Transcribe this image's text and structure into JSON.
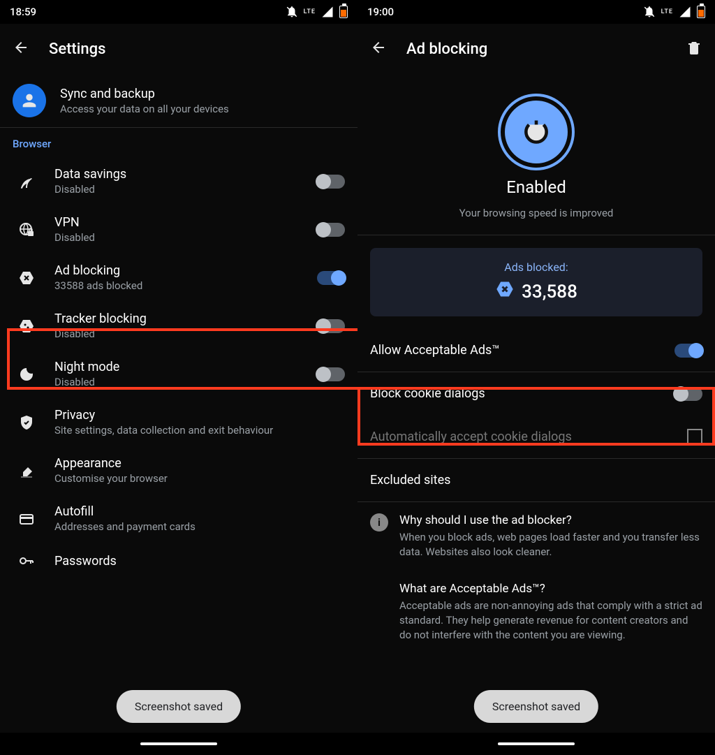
{
  "left": {
    "status_time": "18:59",
    "title": "Settings",
    "sync": {
      "title": "Sync and backup",
      "sub": "Access your data on all your devices"
    },
    "section_browser": "Browser",
    "items": {
      "data_savings": {
        "title": "Data savings",
        "sub": "Disabled",
        "on": false
      },
      "vpn": {
        "title": "VPN",
        "sub": "Disabled",
        "on": false
      },
      "ad_blocking": {
        "title": "Ad blocking",
        "sub": "33588 ads blocked",
        "on": true
      },
      "tracker": {
        "title": "Tracker blocking",
        "sub": "Disabled",
        "on": false
      },
      "night": {
        "title": "Night mode",
        "sub": "Disabled",
        "on": false
      },
      "privacy": {
        "title": "Privacy",
        "sub": "Site settings, data collection and exit behaviour"
      },
      "appearance": {
        "title": "Appearance",
        "sub": "Customise your browser"
      },
      "autofill": {
        "title": "Autofill",
        "sub": "Addresses and payment cards"
      },
      "passwords": {
        "title": "Passwords"
      }
    },
    "toast": "Screenshot saved"
  },
  "right": {
    "status_time": "19:00",
    "title": "Ad blocking",
    "hero": {
      "title": "Enabled",
      "sub": "Your browsing speed is improved"
    },
    "stats": {
      "label": "Ads blocked:",
      "value": "33,588"
    },
    "rows": {
      "acceptable": {
        "label": "Allow Acceptable Ads™",
        "on": true
      },
      "cookie": {
        "label": "Block cookie dialogs",
        "on": false
      },
      "auto_accept": {
        "label": "Automatically accept cookie dialogs"
      },
      "excluded": {
        "label": "Excluded sites"
      }
    },
    "info1": {
      "head": "Why should I use the ad blocker?",
      "body": "When you block ads, web pages load faster and you transfer less data. Websites also look cleaner."
    },
    "info2": {
      "head": "What are Acceptable Ads™?",
      "body": "Acceptable ads are non-annoying ads that comply with a strict ad standard. They help generate revenue for content creators and do not interfere with the content you are viewing."
    },
    "toast": "Screenshot saved"
  },
  "status_lte": "LTE"
}
